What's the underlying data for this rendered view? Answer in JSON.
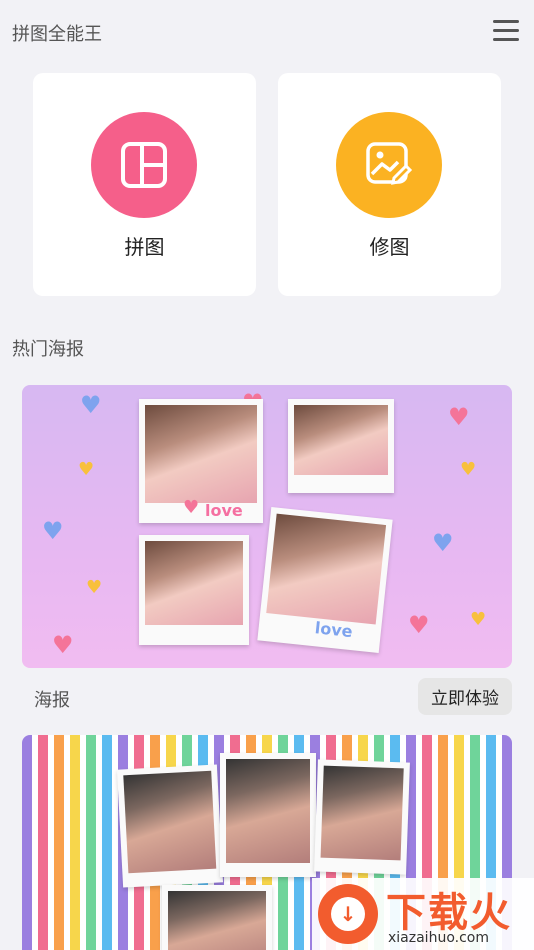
{
  "header": {
    "title": "拼图全能王",
    "menu_icon": "hamburger-menu-icon"
  },
  "tools": [
    {
      "label": "拼图",
      "icon": "collage-layout-icon",
      "color": "#f55f8a"
    },
    {
      "label": "修图",
      "icon": "photo-edit-icon",
      "color": "#fbb222"
    }
  ],
  "section": {
    "title": "热门海报"
  },
  "posters": [
    {
      "caption": "海报",
      "button_label": "立即体验",
      "stickers": [
        "love",
        "love"
      ]
    }
  ],
  "watermark": {
    "brand": "下载火",
    "url": "xiazaihuo.com"
  },
  "colors": {
    "background": "#f2f2f6",
    "card": "#ffffff",
    "accent_pink": "#f55f8a",
    "accent_orange": "#fbb222"
  }
}
